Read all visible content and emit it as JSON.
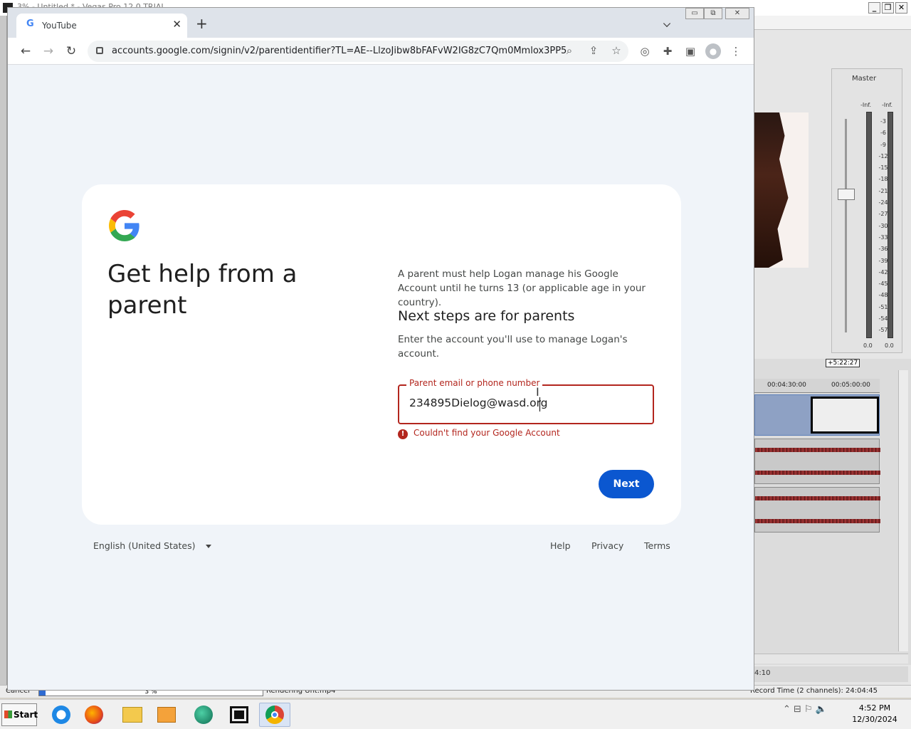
{
  "background_app": {
    "title": "3% - Untitled * - Vegas Pro 12.0 TRIAL",
    "mixer_label": "Master",
    "inf_left": "-Inf.",
    "inf_right": "-Inf.",
    "meter_ticks": [
      "3",
      "6",
      "9",
      "12",
      "15",
      "18",
      "21",
      "24",
      "27",
      "30",
      "33",
      "36",
      "39",
      "42",
      "45",
      "48",
      "51",
      "54",
      "57"
    ],
    "zero_left": "0.0",
    "zero_right": "0.0",
    "timecode": "+5:22:27",
    "ruler_marks": [
      "00:04:30:00",
      "00:05:00:00"
    ],
    "time_readout": "4:10",
    "status_cancel": "Cancel",
    "status_progress": "3 %",
    "progress_fraction": 0.03,
    "status_rendering": "Rendering Unt.mp4",
    "record_time": "Record Time (2 channels): 24:04:45"
  },
  "taskbar": {
    "start_label": "Start",
    "apps": [
      "internet-explorer-icon",
      "firefox-icon",
      "file-explorer-icon",
      "media-player-icon",
      "app-globe-icon",
      "vegas-film-icon",
      "chrome-icon"
    ],
    "clock_time": "4:52 PM",
    "clock_date": "12/30/2024"
  },
  "browser": {
    "tab_title": "YouTube",
    "url": "accounts.google.com/signin/v2/parentidentifier?TL=AE--LlzoJibw8bFAFvW2IG8zC7Qm0Mmlox3PP5...",
    "colors": {
      "accent": "#0b57d0",
      "error": "#b3261e",
      "page_bg": "#f0f4f9"
    }
  },
  "page": {
    "heading": "Get help from a parent",
    "intro": "A parent must help Logan manage his Google Account until he turns 13 (or applicable age in your country).",
    "subheading": "Next steps are for parents",
    "instruction": "Enter the account you'll use to manage Logan's account.",
    "field_label": "Parent email or phone number",
    "field_value": "234895Dielog@wasd.org",
    "error_text": "Couldn't find your Google Account",
    "next_label": "Next"
  },
  "footer": {
    "language": "English (United States)",
    "help": "Help",
    "privacy": "Privacy",
    "terms": "Terms"
  }
}
